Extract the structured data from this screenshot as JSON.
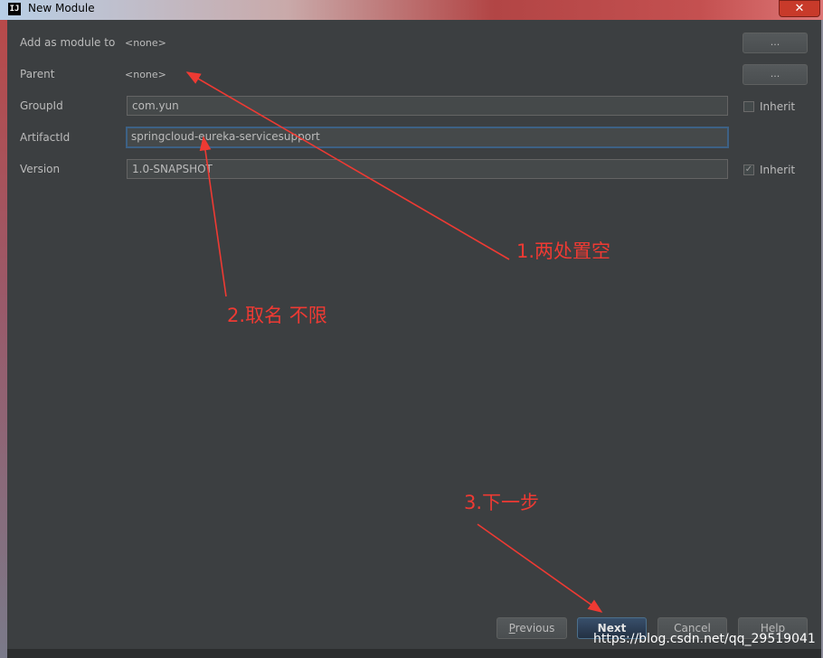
{
  "window": {
    "title": "New Module",
    "app_icon": "IJ",
    "close_label": "✕"
  },
  "form": {
    "add_as_module_to": {
      "label": "Add as module to",
      "value": "<none>",
      "button": "..."
    },
    "parent": {
      "label": "Parent",
      "value": "<none>",
      "button": "..."
    },
    "group_id": {
      "label": "GroupId",
      "value": "com.yun",
      "inherit_label": "Inherit",
      "inherit_checked": false
    },
    "artifact_id": {
      "label": "ArtifactId",
      "value": "springcloud-eureka-servicesupport"
    },
    "version": {
      "label": "Version",
      "value": "1.0-SNAPSHOT",
      "inherit_label": "Inherit",
      "inherit_checked": true,
      "inherit_mark": "✓"
    }
  },
  "buttons": {
    "previous_mnemonic": "P",
    "previous_rest": "revious",
    "next": "Next",
    "cancel": "Cancel",
    "help": "Help"
  },
  "annotations": {
    "note1": "1.两处置空",
    "note2": "2.取名 不限",
    "note3": "3.下一步"
  },
  "watermark": "https://blog.csdn.net/qq_29519041",
  "colors": {
    "annotation": "#ee3a33",
    "background": "#3c3f41",
    "primary_button": "#2f4560"
  }
}
